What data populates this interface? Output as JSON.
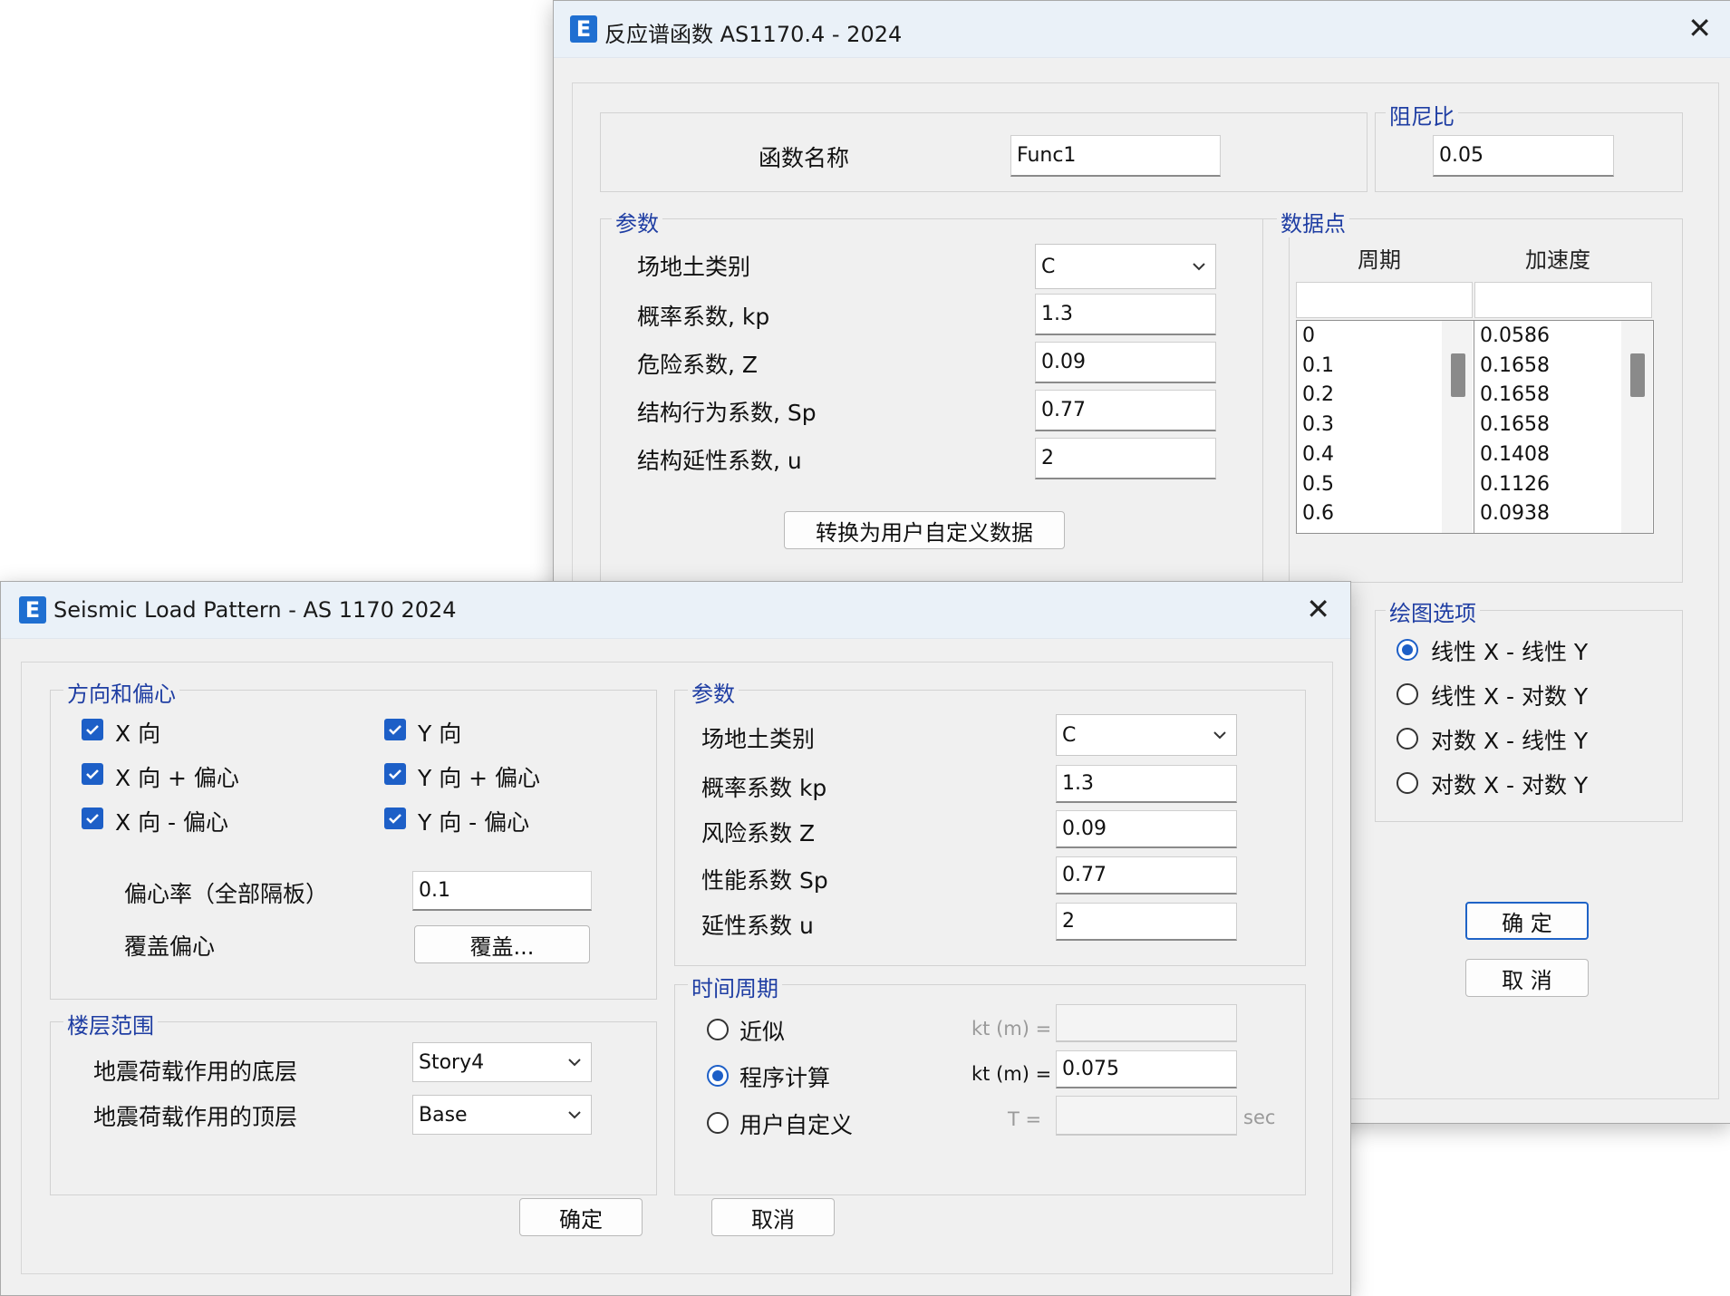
{
  "rs_window": {
    "app_icon": "E",
    "title": "反应谱函数 AS1170.4 - 2024",
    "func_name_label": "函数名称",
    "func_name_value": "Func1",
    "damping_title": "阻尼比",
    "damping_value": "0.05",
    "params": {
      "title": "参数",
      "site_class_label": "场地土类别",
      "site_class_value": "C",
      "kp_label": "概率系数, kp",
      "kp_value": "1.3",
      "z_label": "危险系数, Z",
      "z_value": "0.09",
      "sp_label": "结构行为系数, Sp",
      "sp_value": "0.77",
      "u_label": "结构延性系数, u",
      "u_value": "2",
      "convert_button": "转换为用户自定义数据"
    },
    "datapoints": {
      "title": "数据点",
      "col_period": "周期",
      "col_accel": "加速度",
      "periods": [
        "0",
        "0.1",
        "0.2",
        "0.3",
        "0.4",
        "0.5",
        "0.6"
      ],
      "accels": [
        "0.0586",
        "0.1658",
        "0.1658",
        "0.1658",
        "0.1408",
        "0.1126",
        "0.0938"
      ]
    },
    "plot_options": {
      "title": "绘图选项",
      "options": [
        "线性 X - 线性 Y",
        "线性 X - 对数 Y",
        "对数 X - 线性 Y",
        "对数 X - 对数 Y"
      ],
      "selected_index": 0
    },
    "ok_button": "确 定",
    "cancel_button": "取 消"
  },
  "slp_window": {
    "app_icon": "E",
    "title": "Seismic Load Pattern - AS 1170 2024",
    "direction": {
      "title": "方向和偏心",
      "x_dir": "X 向",
      "x_plus": "X 向 + 偏心",
      "x_minus": "X 向 - 偏心",
      "y_dir": "Y 向",
      "y_plus": "Y 向 + 偏心",
      "y_minus": "Y 向 - 偏心",
      "ecc_label": "偏心率（全部隔板）",
      "ecc_value": "0.1",
      "override_label": "覆盖偏心",
      "override_button": "覆盖..."
    },
    "story_range": {
      "title": "楼层范围",
      "bottom_label": "地震荷载作用的底层",
      "bottom_value": "Story4",
      "top_label": "地震荷载作用的顶层",
      "top_value": "Base"
    },
    "params": {
      "title": "参数",
      "site_class_label": "场地土类别",
      "site_class_value": "C",
      "kp_label": "概率系数 kp",
      "kp_value": "1.3",
      "z_label": "风险系数 Z",
      "z_value": "0.09",
      "sp_label": "性能系数 Sp",
      "sp_value": "0.77",
      "u_label": "延性系数 u",
      "u_value": "2"
    },
    "period": {
      "title": "时间周期",
      "approx_label": "近似",
      "program_label": "程序计算",
      "user_label": "用户自定义",
      "kt_label_1": "kt (m) =",
      "kt_label_2": "kt (m) =",
      "kt_value": "0.075",
      "t_label": "T =",
      "sec_label": "sec"
    },
    "ok_button": "确定",
    "cancel_button": "取消"
  },
  "colors": {
    "accent": "#1d5fc7",
    "group_title": "#1f3ea3",
    "titlebar": "#eaf1f8"
  }
}
